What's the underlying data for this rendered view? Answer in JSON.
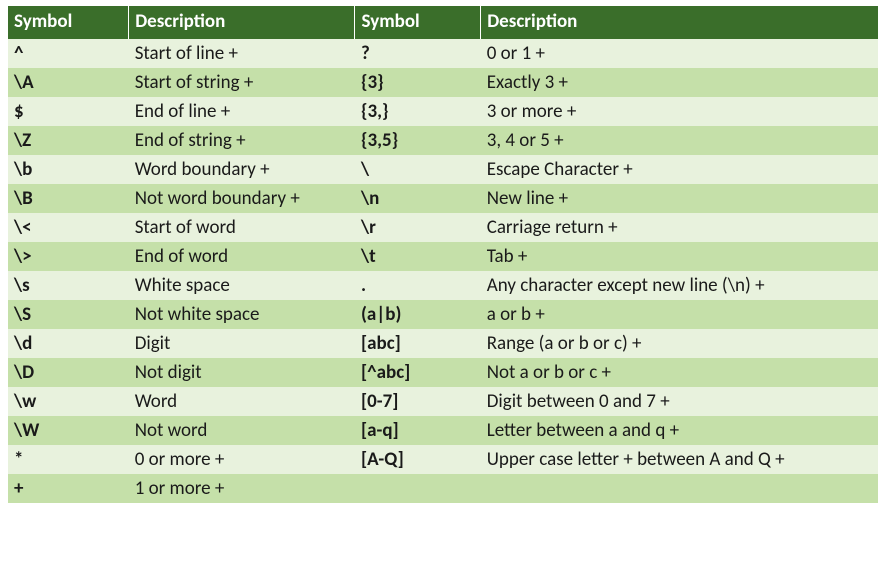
{
  "headers": {
    "symbol1": "Symbol",
    "description1": "Description",
    "symbol2": "Symbol",
    "description2": "Description"
  },
  "rows": [
    {
      "s1": "^",
      "d1": "Start of line +",
      "s2": "?",
      "d2": "0 or 1 +"
    },
    {
      "s1": "\\A",
      "d1": "Start of string +",
      "s2": "{3}",
      "d2": "Exactly 3 +"
    },
    {
      "s1": "$",
      "d1": "End of line +",
      "s2": "{3,}",
      "d2": "3 or more +"
    },
    {
      "s1": "\\Z",
      "d1": "End of string +",
      "s2": "{3,5}",
      "d2": "3, 4 or 5 +"
    },
    {
      "s1": "\\b",
      "d1": "Word boundary +",
      "s2": "\\",
      "d2": "Escape Character +"
    },
    {
      "s1": "\\B",
      "d1": "Not word boundary +",
      "s2": "\\n",
      "d2": "New line +"
    },
    {
      "s1": "\\<",
      "d1": "Start of word",
      "s2": "\\r",
      "d2": "Carriage return +"
    },
    {
      "s1": "\\>",
      "d1": "End of word",
      "s2": "\\t",
      "d2": "Tab +"
    },
    {
      "s1": "\\s",
      "d1": "White space",
      "s2": ".",
      "d2": "Any character except new line (\\n) +"
    },
    {
      "s1": "\\S",
      "d1": "Not white space",
      "s2": "(a|b)",
      "d2": "a or b +"
    },
    {
      "s1": "\\d",
      "d1": "Digit",
      "s2": "[abc]",
      "d2": "Range (a or b or c) +"
    },
    {
      "s1": "\\D",
      "d1": "Not digit",
      "s2": "[^abc]",
      "d2": "Not a or b or c +"
    },
    {
      "s1": "\\w",
      "d1": "Word",
      "s2": "[0-7]",
      "d2": "Digit between 0 and 7 +"
    },
    {
      "s1": "\\W",
      "d1": "Not word",
      "s2": "[a-q]",
      "d2": "Letter between a and q +"
    },
    {
      "s1": "*",
      "d1": "0 or more +",
      "s2": "[A-Q]",
      "d2": "Upper case letter + between A and Q +"
    },
    {
      "s1": "+",
      "d1": "1 or more +",
      "s2": "",
      "d2": ""
    }
  ]
}
